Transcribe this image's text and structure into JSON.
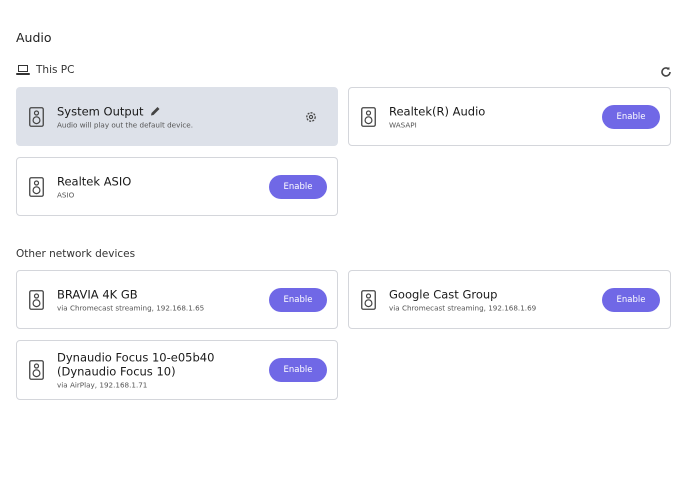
{
  "page": {
    "title": "Audio"
  },
  "this_pc": {
    "heading": "This PC",
    "devices": [
      {
        "name": "System Output",
        "sub": "Audio will play out the default device.",
        "selected": true
      },
      {
        "name": "Realtek(R) Audio",
        "sub": "WASAPI",
        "button": "Enable"
      },
      {
        "name": "Realtek ASIO",
        "sub": "ASIO",
        "button": "Enable"
      }
    ]
  },
  "network": {
    "heading": "Other network devices",
    "devices": [
      {
        "name": "BRAVIA 4K GB",
        "sub": "via Chromecast streaming, 192.168.1.65",
        "button": "Enable"
      },
      {
        "name": "Google Cast Group",
        "sub": "via Chromecast streaming, 192.168.1.69",
        "button": "Enable"
      },
      {
        "name": "Dynaudio Focus 10-e05b40 (Dynaudio Focus 10)",
        "sub": "via AirPlay, 192.168.1.71",
        "button": "Enable"
      }
    ]
  },
  "colors": {
    "accent": "#7068e6",
    "selected_bg": "#dde1e9",
    "border": "#d4d6db"
  },
  "icons": {
    "computer": "laptop-icon",
    "refresh": "refresh-icon",
    "speaker": "speaker-icon",
    "edit": "pencil-icon",
    "settings": "gear-icon"
  }
}
